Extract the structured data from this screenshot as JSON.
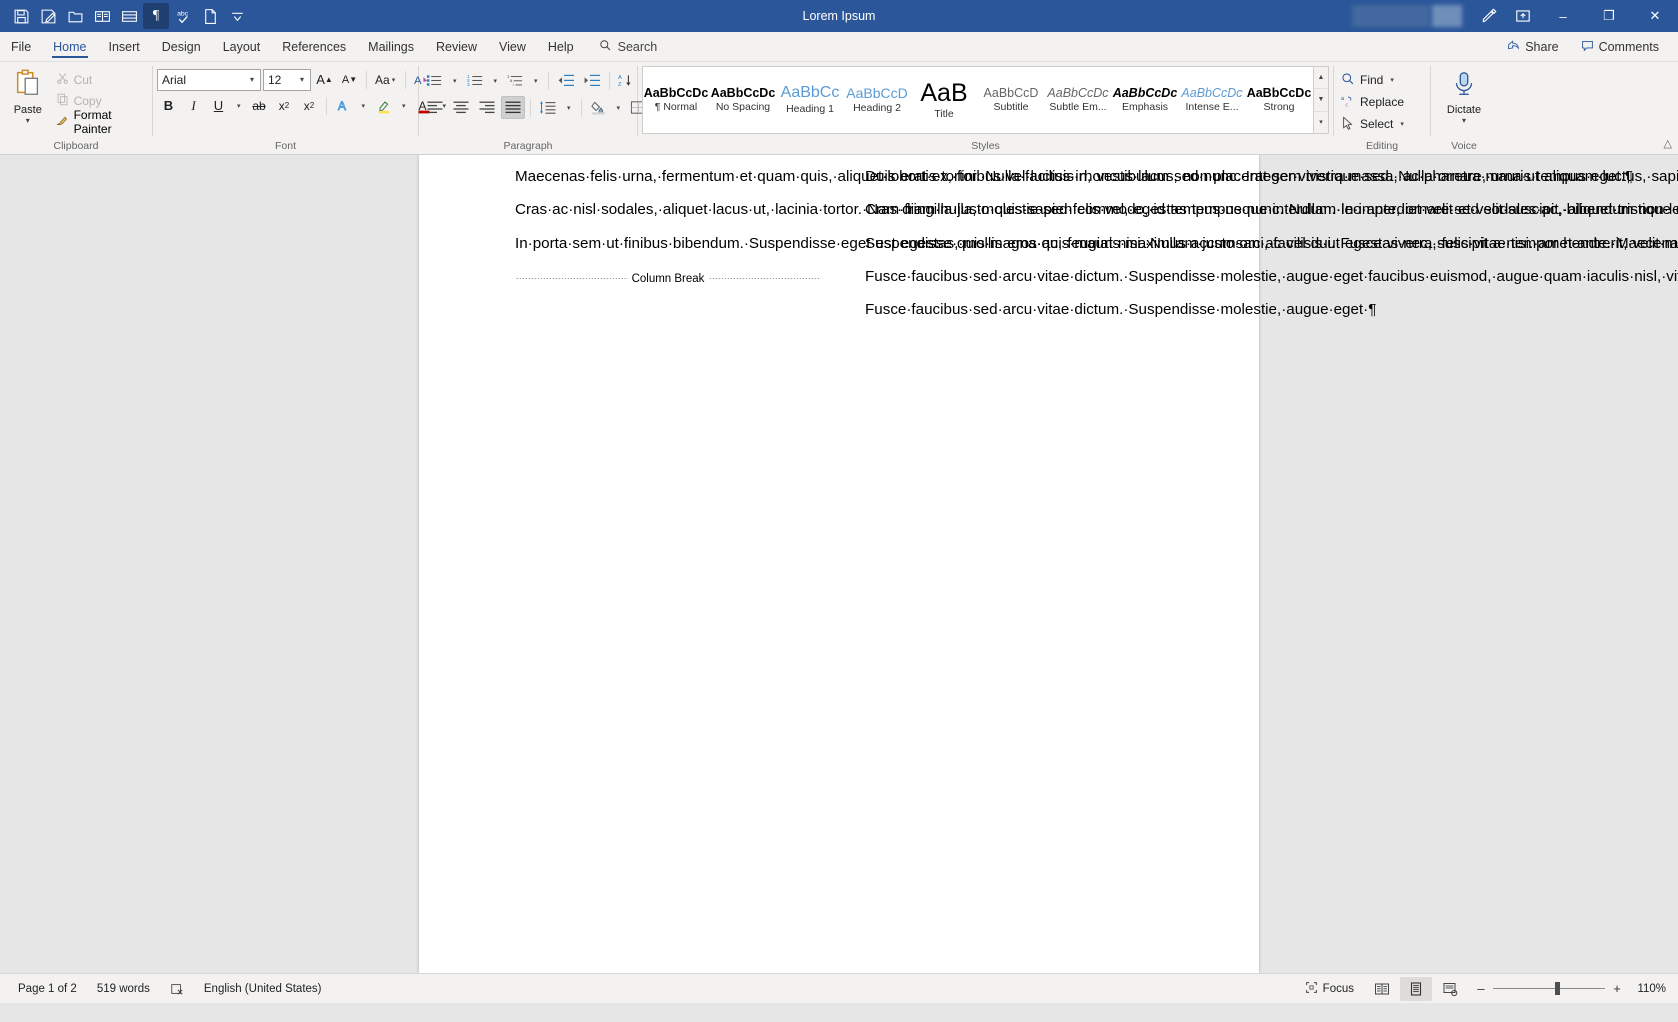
{
  "window": {
    "title": "Lorem Ipsum",
    "quick_access": [
      {
        "name": "save-icon",
        "label": "Save"
      },
      {
        "name": "autosave-icon",
        "label": "Save As"
      },
      {
        "name": "open-folder-icon",
        "label": "Open"
      },
      {
        "name": "read-mode-icon",
        "label": "Read Mode"
      },
      {
        "name": "print-layout-icon",
        "label": "Print Layout"
      },
      {
        "name": "pilcrow-icon",
        "label": "Show Formatting Marks"
      },
      {
        "name": "spelling-check-icon",
        "label": "Spelling & Grammar"
      },
      {
        "name": "new-document-icon",
        "label": "New"
      },
      {
        "name": "customize-qat-icon",
        "label": "Customize Quick Access Toolbar"
      }
    ],
    "editor_icon": "editor-pen-icon",
    "ribbon_display_icon": "ribbon-display-options-icon",
    "minimize": "–",
    "restore": "❐",
    "close": "✕"
  },
  "tabs": [
    {
      "label": "File",
      "active": false
    },
    {
      "label": "Home",
      "active": true
    },
    {
      "label": "Insert",
      "active": false
    },
    {
      "label": "Design",
      "active": false
    },
    {
      "label": "Layout",
      "active": false
    },
    {
      "label": "References",
      "active": false
    },
    {
      "label": "Mailings",
      "active": false
    },
    {
      "label": "Review",
      "active": false
    },
    {
      "label": "View",
      "active": false
    },
    {
      "label": "Help",
      "active": false
    }
  ],
  "search": {
    "label": "Search",
    "icon": "search-icon"
  },
  "tabbar_right": [
    {
      "label": "Share",
      "icon": "share-icon"
    },
    {
      "label": "Comments",
      "icon": "comment-icon"
    }
  ],
  "ribbon": {
    "clipboard": {
      "group_label": "Clipboard",
      "paste": "Paste",
      "cut": "Cut",
      "copy": "Copy",
      "format_painter": "Format Painter"
    },
    "font": {
      "group_label": "Font",
      "font_name": "Arial",
      "font_size": "12",
      "grow_font": "A",
      "shrink_font": "A",
      "change_case": "Aa",
      "clear_formatting": "A",
      "bold": "B",
      "italic": "I",
      "underline": "U",
      "strikethrough": "ab",
      "subscript": "x",
      "subscript_sub": "2",
      "superscript": "x",
      "superscript_sup": "2",
      "text_effects": "A",
      "highlight": "A",
      "font_color": "A"
    },
    "paragraph": {
      "group_label": "Paragraph",
      "bullets": "bullets-icon",
      "numbering": "numbering-icon",
      "multilevel": "multilevel-list-icon",
      "decrease_indent": "decrease-indent-icon",
      "increase_indent": "increase-indent-icon",
      "sort": "sort-icon",
      "show_marks": "¶",
      "align_left": "align-left-icon",
      "align_center": "align-center-icon",
      "align_right": "align-right-icon",
      "justify": "justify-icon",
      "line_spacing": "line-spacing-icon",
      "shading": "shading-icon",
      "borders": "borders-icon",
      "active_alignment": "justify"
    },
    "styles": {
      "group_label": "Styles",
      "items": [
        {
          "preview": "AaBbCcDc",
          "name": "¶ Normal",
          "kind": "normal"
        },
        {
          "preview": "AaBbCcDc",
          "name": "No Spacing",
          "kind": "nospacing"
        },
        {
          "preview": "AaBbCс",
          "name": "Heading 1",
          "kind": "h1"
        },
        {
          "preview": "AaBbCcD",
          "name": "Heading 2",
          "kind": "h2"
        },
        {
          "preview": "AaB",
          "name": "Title",
          "kind": "title"
        },
        {
          "preview": "AaBbCcD",
          "name": "Subtitle",
          "kind": "subtitle"
        },
        {
          "preview": "AaBbCcDc",
          "name": "Subtle Em...",
          "kind": "subtleem"
        },
        {
          "preview": "AaBbCcDc",
          "name": "Emphasis",
          "kind": "emphasis"
        },
        {
          "preview": "AaBbCcDc",
          "name": "Intense E...",
          "kind": "intense"
        },
        {
          "preview": "AaBbCcDc",
          "name": "Strong",
          "kind": "strong"
        }
      ]
    },
    "editing": {
      "group_label": "Editing",
      "find": "Find",
      "replace": "Replace",
      "select": "Select"
    },
    "voice": {
      "group_label": "Voice",
      "dictate": "Dictate"
    }
  },
  "document": {
    "column_break_label": "Column Break",
    "column_one": [
      "Maecenas felis urna, fermentum et quam quis, aliquet lobortis tortor. Nulla facilisis rhoncus lacus, non placerat sem tristique sed. Nulla ornare, urna ut aliquam luctus, sapien ex feugiat augue, quis porttitor neque dui at neque.",
      "Cras ac nisl sodales, aliquet lacus ut, lacinia tortor. Nam fringilla justo quis sapien commodo, id tempus neque interdum. In imperdiet velit et velit suscipit, aliquet tristique elit tempor. Donec viverra sapien augue, et fermentum nibh consectetur vitae. Donec aliquet consectetur malesuada. Proin a lorem justo.",
      "In porta sem ut finibus bibendum. Suspendisse eget est egestas, mollis eros ac, feugiat nisi. Nullam justo orci, facilisis ut egestas nec, suscipit a nisi. amet ante. Maecenas quis dignissim ex. Aliquam eget commodo neque. In nec cursus eros. Nunc quam, mattis eget dictum in, sodales ac ligula. Cras iaculis sem vitae tortor rutrum semper. Nulla volutpat tempor nibh, at scelerisque diam lacinia et. Nunc at eros diam. Pellentesque odio massa, volutpat non massa eget, gravida tempus quam. Proin consectetur convallis molestie."
    ],
    "column_two": [
      "Duis erat ex, finibus vel luctus in, vestibulum sed nunc. Integer viverra massa, ac pharetra mauris tempus eget.",
      "Cras diam nulla, molestie sed felis vel, egestas tempus nunc. Nullam leo ante, ornare sed sodales ac, bibendum non leo. Etiam volutpat vehicula ligula, non tristique turpis blandit non. Nam quis pulvinar velit, nec pulvinar ligula. Vestibulum efficitur bibendum nibh, ut mattis sem varius nec. Orci varius natoque penatibus et magnis dis parturient montes, nascetur ridiculus mus. In tempus varius tincidunt.",
      "Suspendisse quis magna quis mauris maximus accumsan ac vel dui. Fusce viverra, felis vitae tempor hendrerit, velit mi volutpat risus, in hendrerit nisl ex sit ",
      "Fusce faucibus sed arcu vitae dictum. Suspendisse molestie, augue eget faucibus euismod, augue quam iaculis nisl, vitae pretium risus lorem ac massa. Vivamus lacinia, orci in dictum mollis, purus rhoncus urna, et feugiat augue ligula lacinia ex. Pellentesque hendrerit porttitor eros, sed dictum massa dignissim sagittis. Vestibulum in eros sed augue elementum sagittis at eget massa. Praesent at tincidunt enim. Morbi tellus neque, lacinia et diam vitae, dictum tempus dolor. Donec maximus, orci ut porta rutrum, mi metus feugiat felis, in sodales tortor magna eu tellus. Aenean iaculis eleifend velit ut luctus.",
      "Fusce faucibus sed arcu vitae dictum. Suspendisse molestie, augue eget "
    ]
  },
  "status": {
    "page": "Page 1 of 2",
    "words": "519 words",
    "proofing_icon": "proofing-errors-icon",
    "language": "English (United States)",
    "focus": "Focus",
    "views": [
      {
        "name": "read-mode-view",
        "active": false
      },
      {
        "name": "print-layout-view",
        "active": true
      },
      {
        "name": "web-layout-view",
        "active": false
      }
    ],
    "zoom_out": "–",
    "zoom_in": "+",
    "zoom_level": "110%"
  },
  "colors": {
    "word_blue": "#2b579a",
    "ribbon_bg": "#f3f2f1",
    "page_bg": "#e6e6e6"
  }
}
